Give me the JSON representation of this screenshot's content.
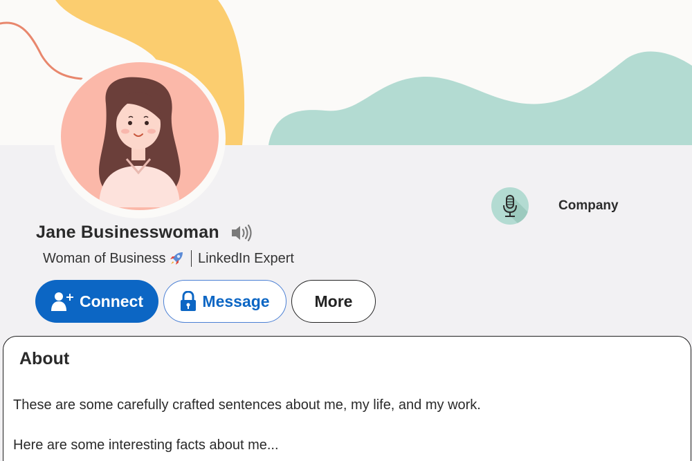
{
  "profile": {
    "name": "Jane Businesswoman",
    "headline_part1": "Woman of Business",
    "headline_part2": "LinkedIn Expert"
  },
  "company": {
    "name": "Company",
    "logo_icon": "microphone-icon"
  },
  "actions": {
    "connect_label": "Connect",
    "message_label": "Message",
    "more_label": "More"
  },
  "about": {
    "title": "About",
    "paragraphs": [
      "These are some carefully crafted sentences about me, my life, and my work.",
      "Here are some interesting facts about me..."
    ]
  },
  "colors": {
    "primary_blue": "#0c66c4",
    "banner_yellow": "#fbcd6f",
    "banner_teal": "#b3dbd2",
    "banner_orange_line": "#e8876d",
    "avatar_background": "#fbb8a9",
    "page_background": "#f2f1f3"
  }
}
